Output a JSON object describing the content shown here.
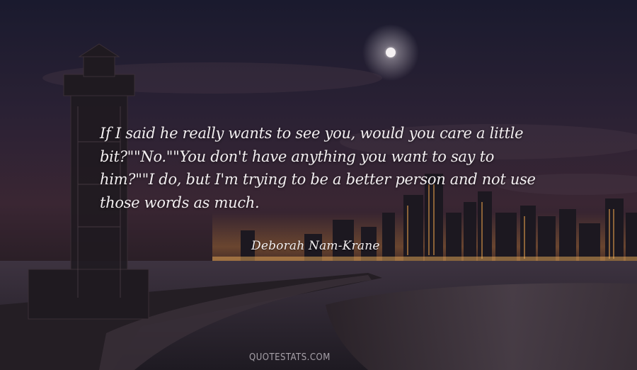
{
  "quote": {
    "lines": [
      "If I said he really wants to see you, would you care a little",
      "bit?\"\"No.\"\"You don't have anything you want to say to",
      "him?\"\"I do, but I'm trying to be a better person and not use",
      "those words as much."
    ]
  },
  "author": "Deborah Nam-Krane",
  "watermark": "QUOTESTATS.COM",
  "colors": {
    "sky_top": "#1a1a2e",
    "horizon_glow": "#d98a3a",
    "text": "#f2eef0",
    "watermark": "#a6a0a8"
  }
}
